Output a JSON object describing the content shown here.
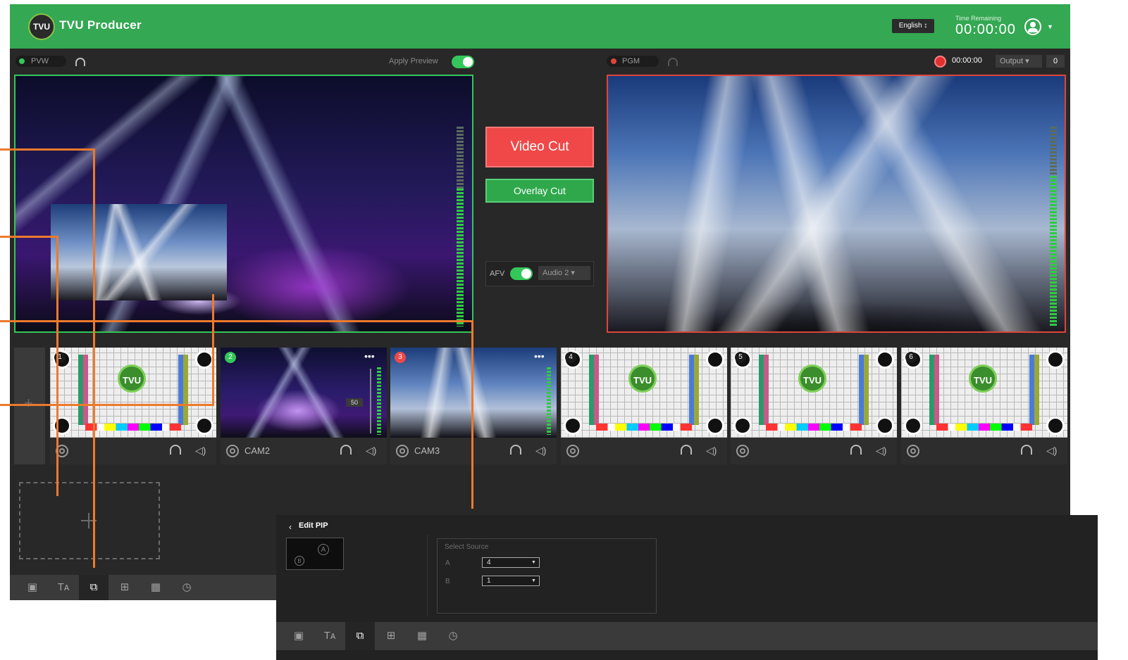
{
  "app": {
    "title": "TVU Producer",
    "logo_text": "TVU",
    "language": "English ↕",
    "time_remaining_label": "Time Remaining",
    "time_remaining_value": "00:00:00"
  },
  "preview": {
    "label": "PVW",
    "apply_preview_label": "Apply Preview"
  },
  "program": {
    "label": "PGM",
    "record_time": "00:00:00",
    "output_label": "Output ▾",
    "output_count": "0"
  },
  "controls": {
    "video_cut_label": "Video Cut",
    "overlay_cut_label": "Overlay Cut",
    "afv_label": "AFV",
    "audio_select": "Audio 2 ▾"
  },
  "sources": [
    {
      "num": "1",
      "name": "",
      "kind": "testcard",
      "badge_color": "#1b1b1b"
    },
    {
      "num": "2",
      "name": "CAM2",
      "kind": "cam2",
      "badge_color": "#34c759",
      "level": "50"
    },
    {
      "num": "3",
      "name": "CAM3",
      "kind": "cam3",
      "badge_color": "#f04848"
    },
    {
      "num": "4",
      "name": "",
      "kind": "testcard",
      "badge_color": "#1b1b1b"
    },
    {
      "num": "5",
      "name": "",
      "kind": "testcard",
      "badge_color": "#1b1b1b"
    },
    {
      "num": "6",
      "name": "",
      "kind": "testcard",
      "badge_color": "#1b1b1b"
    }
  ],
  "strip_add_glyph": "+",
  "testcard_logo": "TVU",
  "pip_editor": {
    "title": "Edit PIP",
    "marker_a": "A",
    "marker_b": "B",
    "select_source_label": "Select Source",
    "row_a_label": "A",
    "row_a_value": "4",
    "row_b_label": "B",
    "row_b_value": "1"
  },
  "icons": {
    "headphone": "headphone-icon",
    "speaker": "🔈",
    "speaker_glyph": "◁)",
    "tools": [
      "▣",
      "Tᴀ",
      "⧉",
      "⊞",
      "▦",
      "◷"
    ]
  },
  "colors": {
    "brand_green": "#34a852",
    "preview_green": "#34c759",
    "program_red": "#e0443a",
    "annotation_orange": "#ec7a2c"
  }
}
